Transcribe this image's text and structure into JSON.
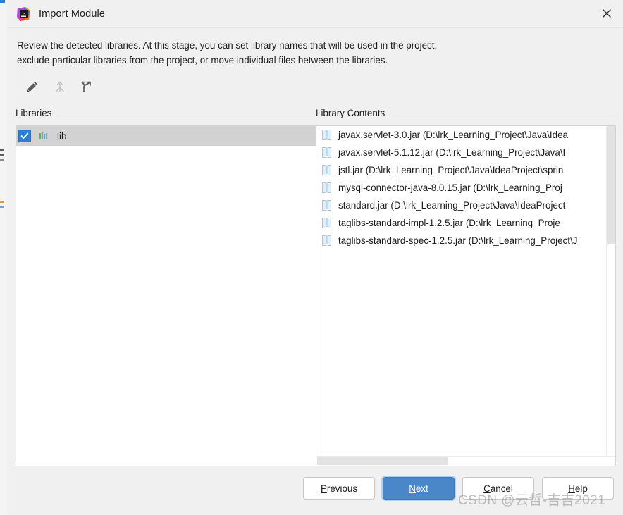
{
  "window": {
    "title": "Import Module",
    "app_icon": "intellij-idea-icon",
    "close_label": "✕"
  },
  "description": {
    "line1": "Review the detected libraries. At this stage, you can set library names that will be used in the project,",
    "line2": "exclude particular libraries from the project, or move individual files between the libraries."
  },
  "toolbar": {
    "items": [
      {
        "name": "edit-icon",
        "title": "Edit",
        "enabled": true
      },
      {
        "name": "merge-icon",
        "title": "Merge",
        "enabled": false
      },
      {
        "name": "split-icon",
        "title": "Split",
        "enabled": true
      }
    ]
  },
  "libraries_panel": {
    "title": "Libraries",
    "items": [
      {
        "label": "lib",
        "checked": true,
        "selected": true
      }
    ]
  },
  "contents_panel": {
    "title": "Library Contents",
    "items": [
      {
        "label": "javax.servlet-3.0.jar (D:\\lrk_Learning_Project\\Java\\Idea"
      },
      {
        "label": "javax.servlet-5.1.12.jar (D:\\lrk_Learning_Project\\Java\\I"
      },
      {
        "label": "jstl.jar (D:\\lrk_Learning_Project\\Java\\IdeaProject\\sprin"
      },
      {
        "label": "mysql-connector-java-8.0.15.jar (D:\\lrk_Learning_Proj"
      },
      {
        "label": "standard.jar (D:\\lrk_Learning_Project\\Java\\IdeaProject"
      },
      {
        "label": "taglibs-standard-impl-1.2.5.jar (D:\\lrk_Learning_Proje"
      },
      {
        "label": "taglibs-standard-spec-1.2.5.jar (D:\\lrk_Learning_Project\\J"
      }
    ]
  },
  "footer": {
    "buttons": [
      {
        "name": "previous-button",
        "mnemonic": "P",
        "rest": "revious",
        "primary": false
      },
      {
        "name": "next-button",
        "mnemonic": "N",
        "rest": "ext",
        "primary": true
      },
      {
        "name": "cancel-button",
        "mnemonic": "C",
        "rest": "ancel",
        "primary": false
      },
      {
        "name": "help-button",
        "mnemonic": "H",
        "rest": "elp",
        "primary": false
      }
    ]
  },
  "watermark": {
    "text": "CSDN @云哲-吉吉2021"
  },
  "colors": {
    "dialog_bg": "#f0f0f0",
    "panel_bg": "#ffffff",
    "selection_bg": "#d2d2d2",
    "checkbox_blue": "#2980d8",
    "primary_button": "#4a87c8",
    "focus_ring": "#b3d0ea"
  }
}
